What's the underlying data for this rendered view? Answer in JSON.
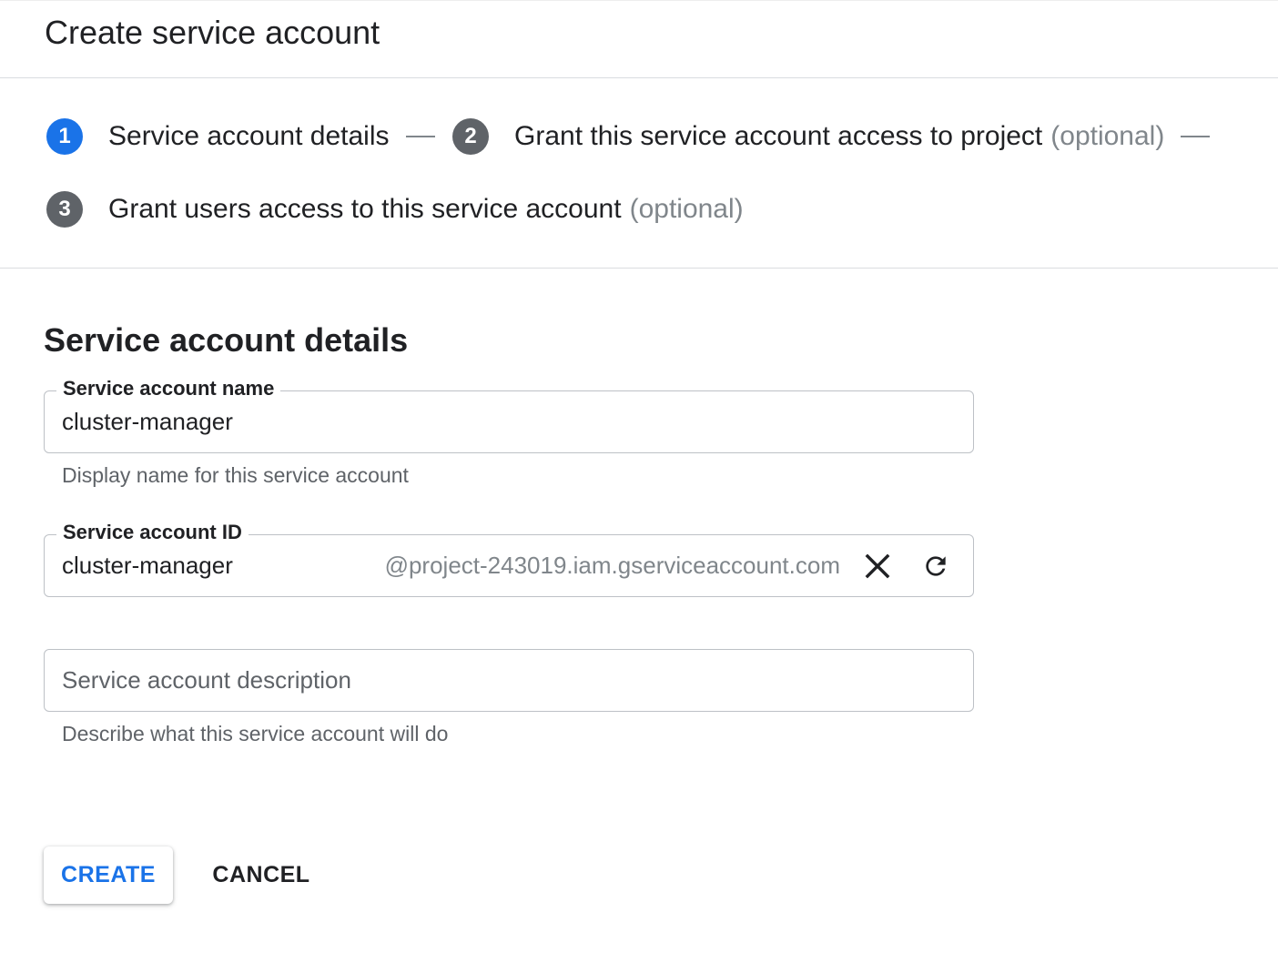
{
  "header": {
    "title": "Create service account"
  },
  "stepper": {
    "steps": [
      {
        "number": "1",
        "label": "Service account details",
        "optional": "",
        "active": true
      },
      {
        "number": "2",
        "label": "Grant this service account access to project",
        "optional": "(optional)",
        "active": false
      },
      {
        "number": "3",
        "label": "Grant users access to this service account",
        "optional": "(optional)",
        "active": false
      }
    ]
  },
  "form": {
    "section_title": "Service account details",
    "name_field": {
      "label": "Service account name",
      "value": "cluster-manager",
      "hint": "Display name for this service account"
    },
    "id_field": {
      "label": "Service account ID",
      "value": "cluster-manager",
      "suffix": "@project-243019.iam.gserviceaccount.com",
      "clear_icon": "close-icon",
      "refresh_icon": "refresh-icon"
    },
    "description_field": {
      "placeholder": "Service account description",
      "value": "",
      "hint": "Describe what this service account will do"
    }
  },
  "actions": {
    "create_label": "CREATE",
    "cancel_label": "CANCEL"
  },
  "colors": {
    "accent": "#1a73e8",
    "step_inactive": "#5f6368",
    "border": "#bdc1c6",
    "divider": "#dadce0"
  }
}
